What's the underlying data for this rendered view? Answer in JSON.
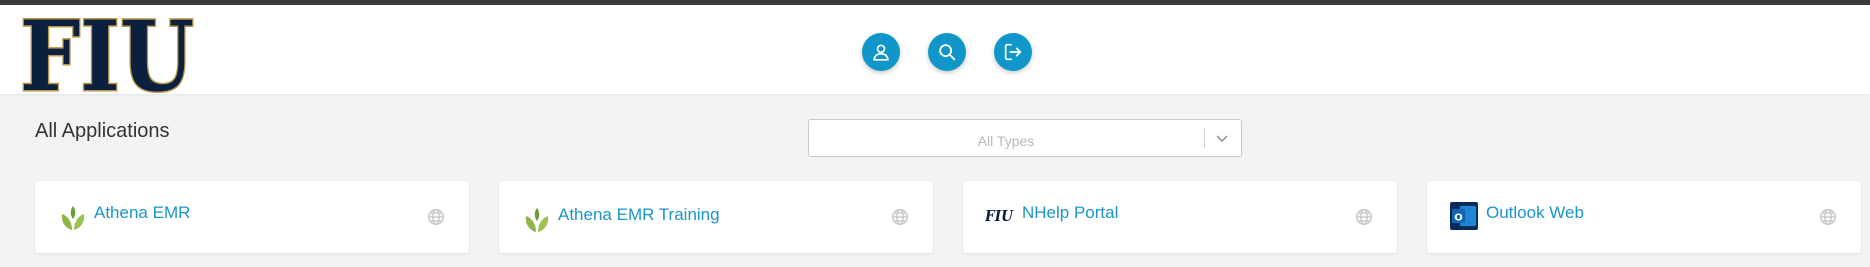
{
  "header": {
    "logo_text": "FIU",
    "buttons": [
      {
        "name": "profile-button",
        "icon": "user-icon"
      },
      {
        "name": "search-button",
        "icon": "search-icon"
      },
      {
        "name": "logout-button",
        "icon": "sign-out-icon"
      }
    ]
  },
  "main": {
    "title": "All Applications",
    "type_filter": {
      "placeholder": "All Types"
    },
    "apps": [
      {
        "label": "Athena EMR",
        "icon": "athena-leaf-icon"
      },
      {
        "label": "Athena EMR Training",
        "icon": "athena-leaf-icon"
      },
      {
        "label": "NHelp Portal",
        "icon": "fiu-logo-icon",
        "icon_text": "FIU"
      },
      {
        "label": "Outlook Web",
        "icon": "outlook-icon",
        "icon_text": "O"
      }
    ]
  },
  "colors": {
    "accent": "#1196c9",
    "link": "#1a95c6",
    "fiu_navy": "#0b1f3f",
    "fiu_gold": "#b8954b",
    "page_bg": "#f2f3f3"
  }
}
